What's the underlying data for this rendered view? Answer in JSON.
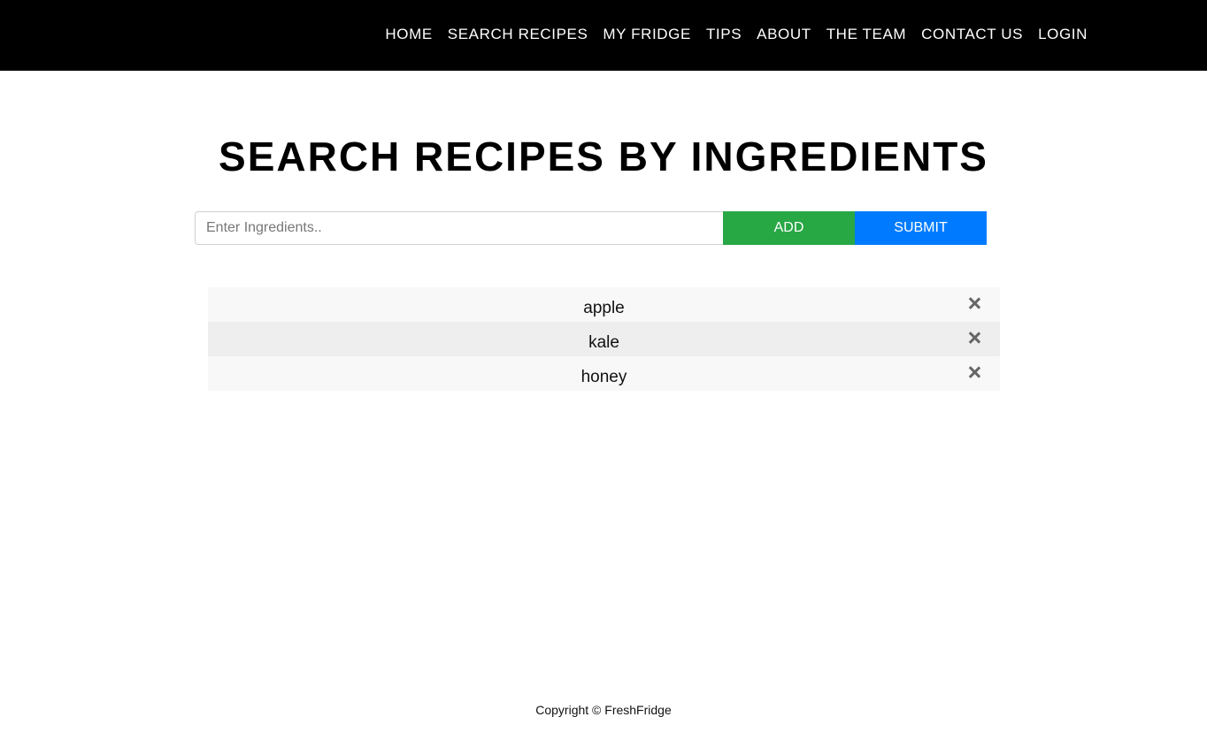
{
  "nav": {
    "items": [
      {
        "label": "HOME"
      },
      {
        "label": "SEARCH RECIPES"
      },
      {
        "label": "MY FRIDGE"
      },
      {
        "label": "TIPS"
      },
      {
        "label": "ABOUT"
      },
      {
        "label": "THE TEAM"
      },
      {
        "label": "CONTACT US"
      },
      {
        "label": "LOGIN"
      }
    ]
  },
  "main": {
    "title": "SEARCH RECIPES BY INGREDIENTS",
    "search": {
      "placeholder": "Enter Ingredients..",
      "value": "",
      "add_label": "ADD",
      "submit_label": "SUBMIT"
    },
    "ingredients": [
      {
        "name": "apple",
        "remove_icon": "close-icon"
      },
      {
        "name": "kale",
        "remove_icon": "close-icon"
      },
      {
        "name": "honey",
        "remove_icon": "close-icon"
      }
    ]
  },
  "footer": {
    "copyright": "Copyright © FreshFridge"
  },
  "colors": {
    "navbar_bg": "#000000",
    "add_button": "#28a745",
    "submit_button": "#007bff"
  }
}
